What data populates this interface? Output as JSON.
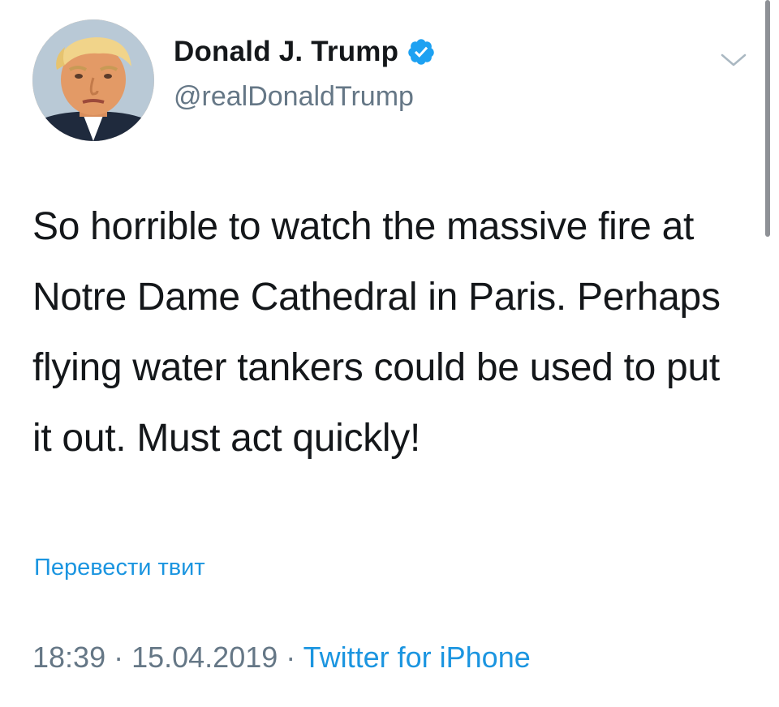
{
  "tweet": {
    "display_name": "Donald J. Trump",
    "handle": "@realDonaldTrump",
    "verified": true,
    "text": "So horrible to watch the massive fire at Notre Dame Cathedral in Paris. Perhaps flying water tankers could be used to put it out. Must act quickly!",
    "translate_label": "Перевести твит",
    "time": "18:39",
    "separator": " · ",
    "date": "15.04.2019",
    "source": "Twitter for iPhone"
  },
  "icons": {
    "verified": "verified-badge-icon",
    "menu": "chevron-down-icon",
    "avatar": "profile-photo"
  },
  "colors": {
    "link": "#1b95e0",
    "secondary_text": "#657786",
    "verified_badge": "#1da1f2",
    "primary_text": "#14171a"
  }
}
